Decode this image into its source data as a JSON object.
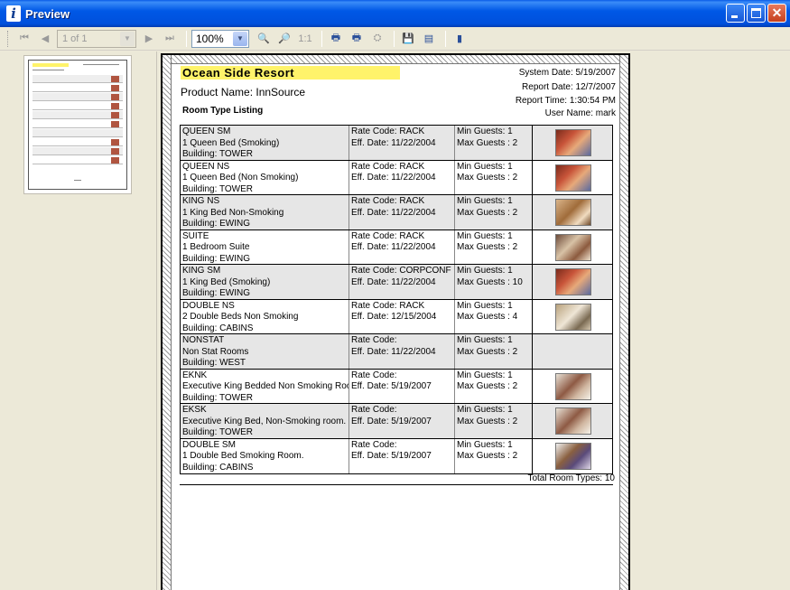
{
  "window": {
    "title": "Preview"
  },
  "toolbar": {
    "page_indicator": "1 of 1",
    "zoom": "100%",
    "icons": [
      "first-page-icon",
      "prev-page-icon",
      "next-page-icon",
      "last-page-icon",
      "zoom-in-icon",
      "zoom-out-icon",
      "actual-size-icon",
      "print-icon",
      "print-setup-icon",
      "export-icon",
      "save-icon",
      "email-icon",
      "close-preview-icon"
    ]
  },
  "report": {
    "resort_name": "Ocean Side Resort",
    "product_name": "Product Name: InnSource",
    "listing_title": "Room Type Listing",
    "system_date": "System Date: 5/19/2007",
    "report_date": "Report Date: 12/7/2007",
    "report_time": "Report Time: 1:30:54 PM",
    "user_name": "User Name: mark",
    "rows": [
      {
        "code": "QUEEN SM",
        "desc": "1 Queen Bed (Smoking)",
        "building": "Building: TOWER",
        "rate": "Rate Code: RACK",
        "eff": "Eff. Date: 11/22/2004",
        "min": "Min Guests: 1",
        "max": "Max Guests : 2",
        "photo": "a"
      },
      {
        "code": "QUEEN NS",
        "desc": "1 Queen Bed (Non Smoking)",
        "building": "Building: TOWER",
        "rate": "Rate Code: RACK",
        "eff": "Eff. Date: 11/22/2004",
        "min": "Min Guests: 1",
        "max": "Max Guests : 2",
        "photo": "a"
      },
      {
        "code": "KING NS",
        "desc": "1 King Bed Non-Smoking",
        "building": "Building: EWING",
        "rate": "Rate Code: RACK",
        "eff": "Eff. Date: 11/22/2004",
        "min": "Min Guests: 1",
        "max": "Max Guests : 2",
        "photo": "b"
      },
      {
        "code": "SUITE",
        "desc": "1 Bedroom Suite",
        "building": "Building: EWING",
        "rate": "Rate Code: RACK",
        "eff": "Eff. Date: 11/22/2004",
        "min": "Min Guests: 1",
        "max": "Max Guests : 2",
        "photo": "c"
      },
      {
        "code": "KING SM",
        "desc": "1 King Bed (Smoking)",
        "building": "Building: EWING",
        "rate": "Rate Code: CORPCONF",
        "eff": "Eff. Date: 11/22/2004",
        "min": "Min Guests: 1",
        "max": "Max Guests : 10",
        "photo": "a"
      },
      {
        "code": "DOUBLE NS",
        "desc": "2 Double Beds Non Smoking",
        "building": "Building: CABINS",
        "rate": "Rate Code: RACK",
        "eff": "Eff. Date: 12/15/2004",
        "min": "Min Guests: 1",
        "max": "Max Guests : 4",
        "photo": "d"
      },
      {
        "code": "NONSTAT",
        "desc": "Non Stat Rooms",
        "building": "Building: WEST",
        "rate": "Rate Code:",
        "eff": "Eff. Date: 11/22/2004",
        "min": "Min Guests: 1",
        "max": "Max Guests : 2",
        "photo": ""
      },
      {
        "code": "EKNK",
        "desc": "Executive King Bedded Non Smoking Roor",
        "building": "Building: TOWER",
        "rate": "Rate Code:",
        "eff": "Eff. Date: 5/19/2007",
        "min": "Min Guests: 1",
        "max": "Max Guests : 2",
        "photo": "e"
      },
      {
        "code": "EKSK",
        "desc": "Executive King Bed, Non-Smoking room. F",
        "building": "Building: TOWER",
        "rate": "Rate Code:",
        "eff": "Eff. Date: 5/19/2007",
        "min": "Min Guests: 1",
        "max": "Max Guests : 2",
        "photo": "e"
      },
      {
        "code": "DOUBLE SM",
        "desc": "1 Double Bed Smoking Room.",
        "building": "Building: CABINS",
        "rate": "Rate Code:",
        "eff": "Eff. Date: 5/19/2007",
        "min": "Min Guests: 1",
        "max": "Max Guests : 2",
        "photo": "f"
      }
    ],
    "total": "Total Room Types: 10"
  }
}
